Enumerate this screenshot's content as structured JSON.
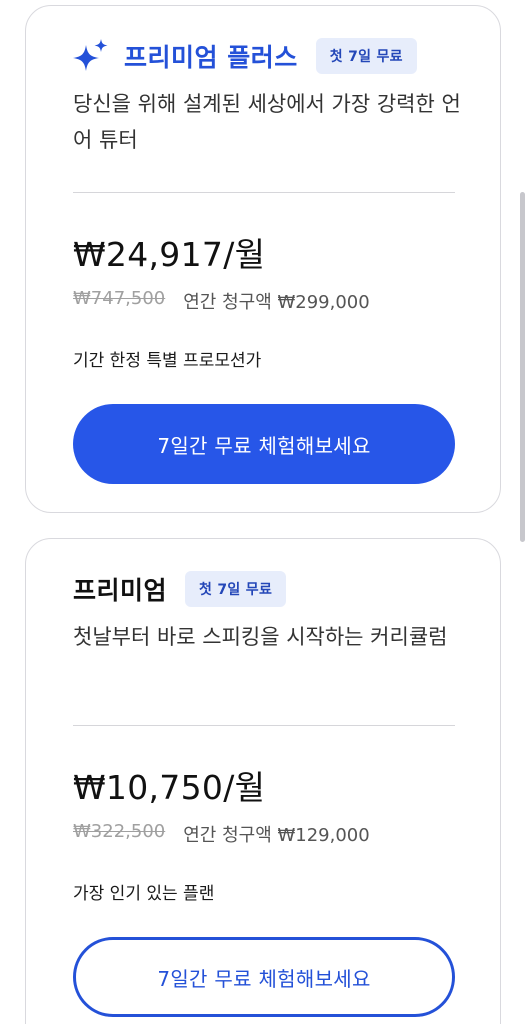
{
  "plans": [
    {
      "title": "프리미엄 플러스",
      "badge": "첫 7일 무료",
      "description": "당신을 위해 설계된 세상에서 가장 강력한 언어 튜터",
      "price": "₩24,917/월",
      "original_price": "₩747,500",
      "annual_billing": "연간 청구액 ₩299,000",
      "promo_note": "기간 한정 특별 프로모션가",
      "cta_label": "7일간 무료 체험해보세요",
      "icon": "sparkle-icon"
    },
    {
      "title": "프리미엄",
      "badge": "첫 7일 무료",
      "description": "첫날부터 바로 스피킹을 시작하는 커리큘럼",
      "price": "₩10,750/월",
      "original_price": "₩322,500",
      "annual_billing": "연간 청구액 ₩129,000",
      "promo_note": "가장 인기 있는 플랜",
      "cta_label": "7일간 무료 체험해보세요"
    }
  ],
  "colors": {
    "accent": "#2756e8",
    "accent_text": "#2451d8",
    "badge_bg": "#e7edfb",
    "card_border": "#d9d9de"
  }
}
